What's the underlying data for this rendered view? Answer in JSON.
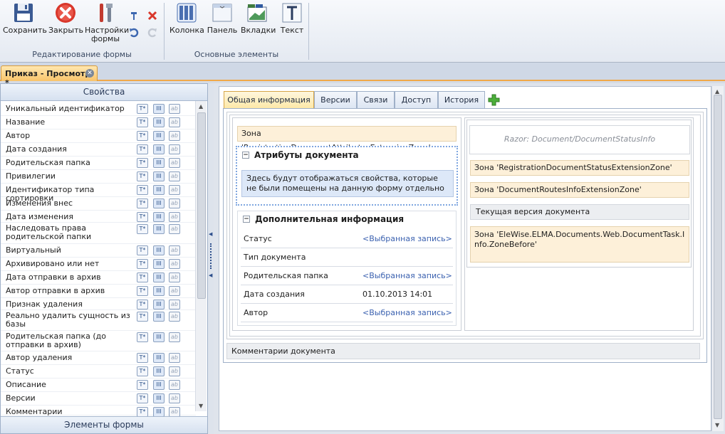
{
  "ribbon": {
    "buttons": [
      {
        "id": "save",
        "label": "Сохранить",
        "icon": "floppy-disk-icon"
      },
      {
        "id": "close",
        "label": "Закрыть",
        "icon": "red-close-circle-icon"
      },
      {
        "id": "settings",
        "label": "Настройки формы",
        "icon": "tools-icon"
      },
      {
        "id": "column",
        "label": "Колонка",
        "icon": "column-icon"
      },
      {
        "id": "panel",
        "label": "Панель",
        "icon": "panel-icon"
      },
      {
        "id": "tabs",
        "label": "Вкладки",
        "icon": "tabs-icon"
      },
      {
        "id": "text",
        "label": "Текст",
        "icon": "text-icon"
      }
    ],
    "settings_line1": "Настройки",
    "settings_line2": "формы",
    "group1_label": "Редактирование формы",
    "group2_label": "Основные элементы",
    "small_icons": [
      "hammer-icon",
      "red-x-icon",
      "undo-icon",
      "redo-icon"
    ]
  },
  "doc_tab": {
    "title": "Приказ - Просмотр *"
  },
  "properties": {
    "header": "Свойства",
    "footer": "Элементы формы",
    "icons": {
      "t": "T*",
      "i": "III",
      "a": "ab"
    },
    "items": [
      "Уникальный идентификатор",
      "Название",
      "Автор",
      "Дата создания",
      "Родительская папка",
      "Привилегии",
      "Идентификатор типа сортировки",
      "Изменения внес",
      "Дата изменения",
      "Наследовать права родительской папки",
      "Виртуальный",
      "Архивировано или нет",
      "Дата отправки в архив",
      "Автор отправки в архив",
      "Признак удаления",
      "Реально удалить сущность из базы",
      "Родительская папка (до отправки в архив)",
      "Автор удаления",
      "Статус",
      "Описание",
      "Версии",
      "Комментарии"
    ]
  },
  "form": {
    "tabs": [
      "Общая информация",
      "Версии",
      "Связи",
      "Доступ",
      "История"
    ],
    "active_tab": "Общая информация",
    "zone_attr": "Зона 'RegistrationDocumentAttributesExtensionZone'",
    "attr_section_title": "Атрибуты документа",
    "attr_note": "Здесь будут отображаться свойства, которые не были помещены на данную форму отдельно",
    "extra_section_title": "Дополнительная информация",
    "fields": [
      {
        "label": "Статус",
        "value": "<Выбранная запись>",
        "link": true
      },
      {
        "label": "Тип документа",
        "value": "",
        "link": false
      },
      {
        "label": "Родительская папка",
        "value": "<Выбранная запись>",
        "link": true
      },
      {
        "label": "Дата создания",
        "value": "01.10.2013 14:01",
        "link": false
      },
      {
        "label": "Автор",
        "value": "<Выбранная запись>",
        "link": true
      }
    ],
    "razor": "Razor: Document/DocumentStatusInfo",
    "zone_status": "Зона 'RegistrationDocumentStatusExtensionZone'",
    "zone_routes": "Зона 'DocumentRoutesInfoExtensionZone'",
    "current_version": "Текущая версия документа",
    "zone_task": "Зона 'EleWise.ELMA.Documents.Web.DocumentTask.Info.ZoneBefore'",
    "comments": "Комментарии документа"
  },
  "colors": {
    "active_tab": "#f9c46a",
    "zone_bg": "#fdf0d9",
    "link": "#3c62b0"
  }
}
